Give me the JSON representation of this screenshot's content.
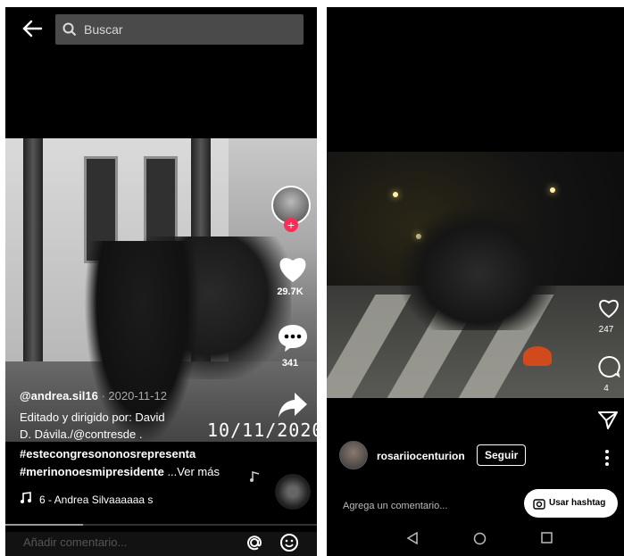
{
  "left": {
    "search": {
      "placeholder": "Buscar"
    },
    "post": {
      "username": "@andrea.sil16",
      "date": " · 2020-11-12",
      "overlay_date": "10/11/2020",
      "caption_lines": [
        "Editado y dirigido por: David",
        "D. Dávila./@contresde ."
      ],
      "hashtag_1": "#estecongresononosrepresenta",
      "hashtag_2": "#merinonoesmipresidente",
      "see_more": " ...Ver más",
      "sound": "6 - Andrea Silvaaaaaa   s",
      "likes": "29.7K",
      "comments": "341",
      "progress_fraction": 0.25
    },
    "comment_placeholder": "Añadir comentario...",
    "colors": {
      "accent": "#fe2c55"
    },
    "icons": [
      "back-arrow-icon",
      "search-icon",
      "heart-icon",
      "comment-icon",
      "share-icon",
      "music-note-icon",
      "at-icon",
      "emoji-icon"
    ]
  },
  "right": {
    "post": {
      "username": "rosariiocenturion",
      "follow_label": "Seguir",
      "likes": "247",
      "comments": "4"
    },
    "comment_placeholder": "Agrega un comentario...",
    "hashtag_button": "Usar hashtag",
    "icons": [
      "heart-icon",
      "comment-icon",
      "send-icon",
      "more-icon",
      "camera-icon",
      "nav-back-icon",
      "nav-home-icon",
      "nav-recent-icon"
    ]
  }
}
